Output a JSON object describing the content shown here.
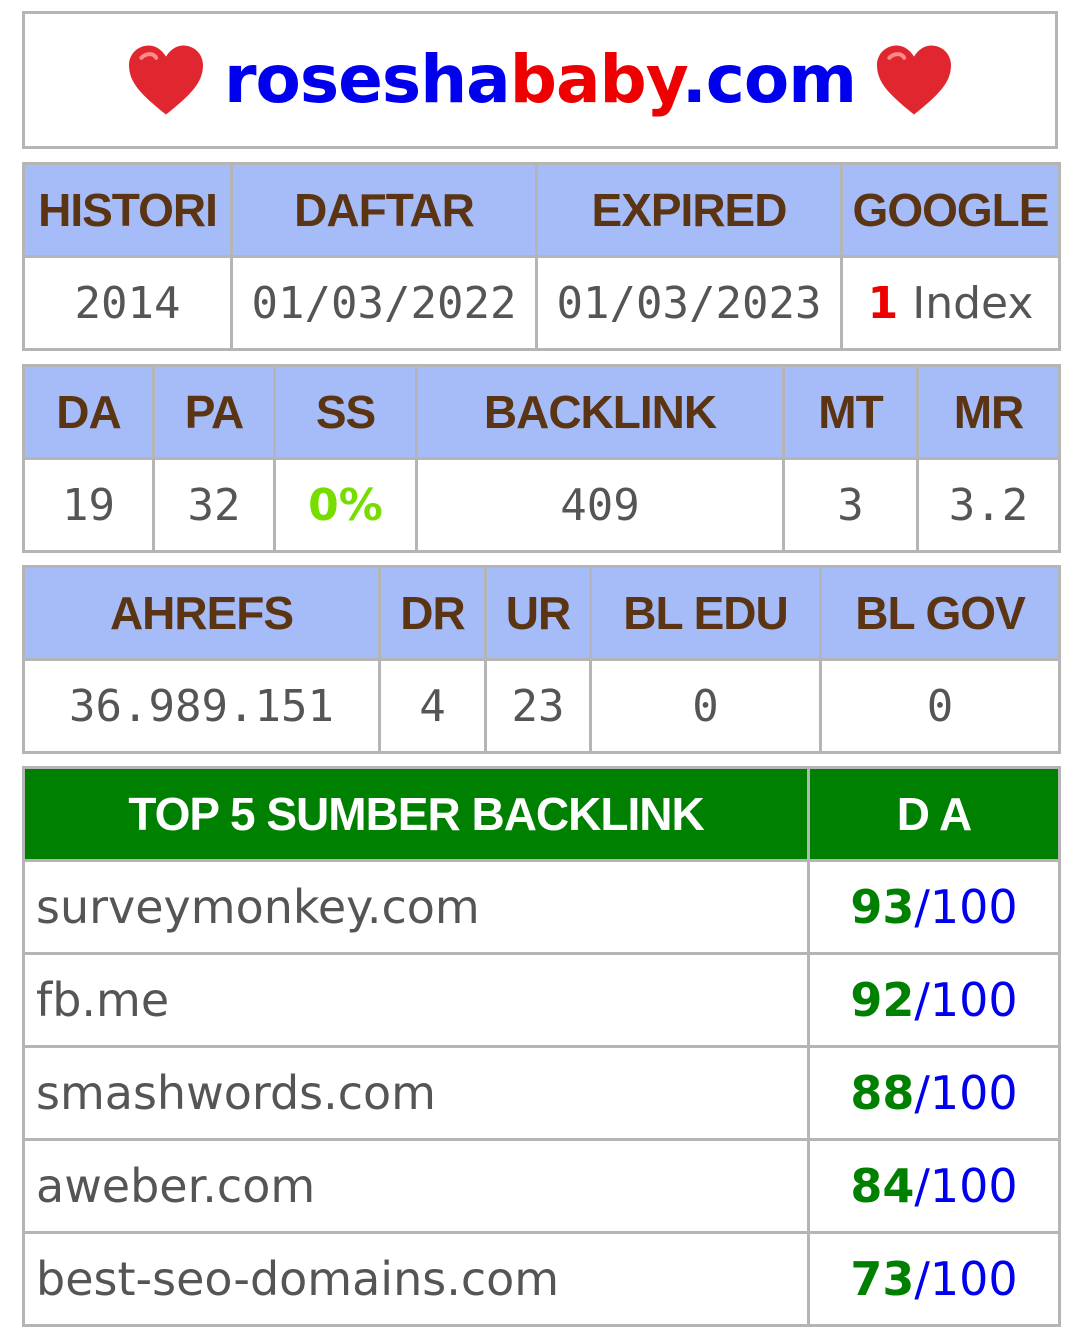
{
  "title": {
    "part1": "rosesha",
    "part2": "baby",
    "part3": ".com",
    "colors": {
      "blue": "#0000ee",
      "red": "#ee0000"
    }
  },
  "info": {
    "headers": [
      "HISTORI",
      "DAFTAR",
      "EXPIRED",
      "GOOGLE"
    ],
    "histori": "2014",
    "daftar": "01/03/2022",
    "expired": "01/03/2023",
    "google_count": "1",
    "google_label": " Index"
  },
  "moz": {
    "headers": [
      "DA",
      "PA",
      "SS",
      "BACKLINK",
      "MT",
      "MR"
    ],
    "values": [
      "19",
      "32",
      "0%",
      "409",
      "3",
      "3.2"
    ]
  },
  "ahrefs": {
    "headers": [
      "AHREFS",
      "DR",
      "UR",
      "BL EDU",
      "BL GOV"
    ],
    "values": [
      "36.989.151",
      "4",
      "23",
      "0",
      "0"
    ]
  },
  "top_backlinks": {
    "header_source": "TOP 5 SUMBER BACKLINK",
    "header_da": "D A",
    "rows": [
      {
        "site": "surveymonkey.com",
        "da": "93",
        "max": "/100"
      },
      {
        "site": "fb.me",
        "da": "92",
        "max": "/100"
      },
      {
        "site": "smashwords.com",
        "da": "88",
        "max": "/100"
      },
      {
        "site": "aweber.com",
        "da": "84",
        "max": "/100"
      },
      {
        "site": "best-seo-domains.com",
        "da": "73",
        "max": "/100"
      }
    ]
  },
  "icons": {
    "heart": "heart-icon"
  }
}
